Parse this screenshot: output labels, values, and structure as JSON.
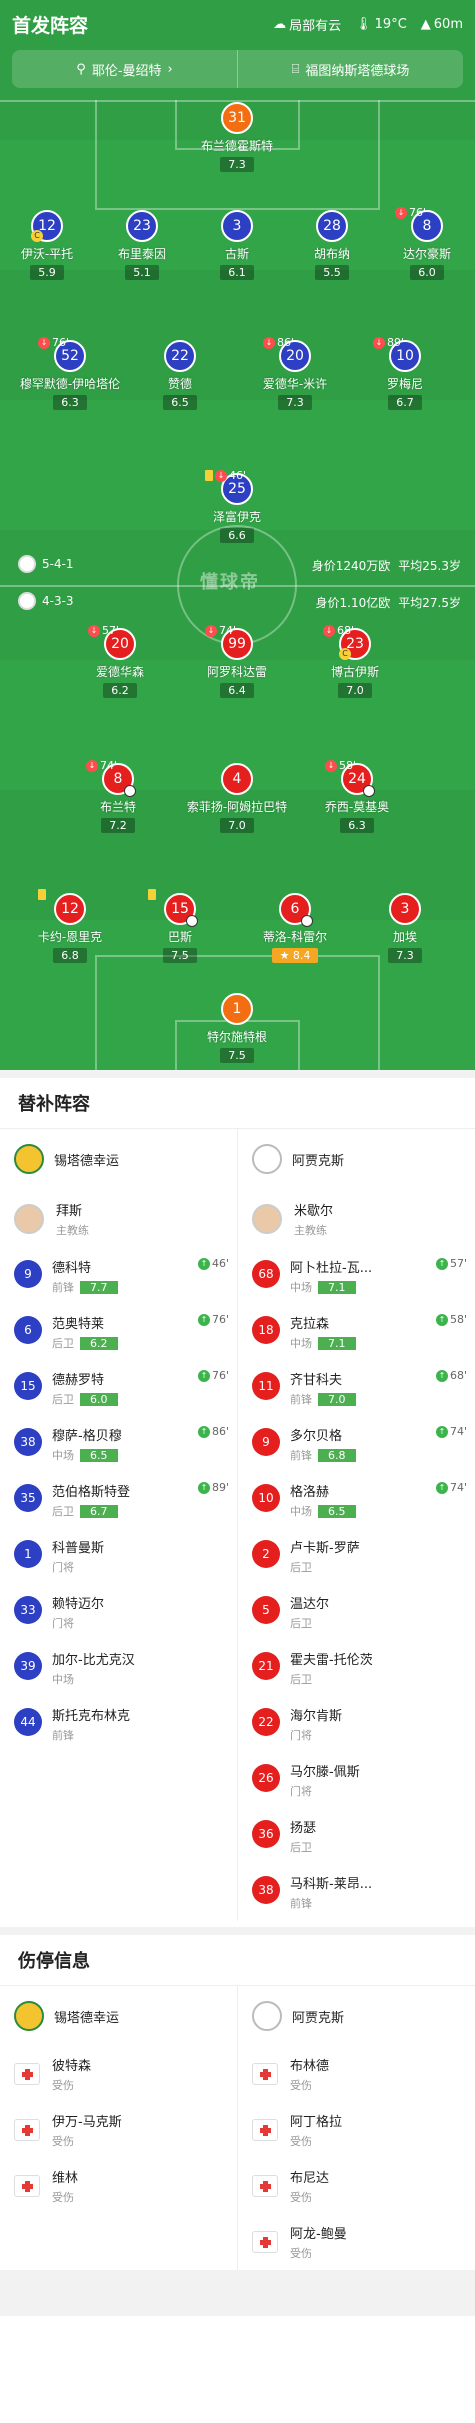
{
  "header": {
    "title": "首发阵容",
    "weather": "局部有云",
    "temp": "19°C",
    "altitude": "60m"
  },
  "match": {
    "referee": "耶伦-曼绍特",
    "venue": "福图纳斯塔德球场"
  },
  "home_info": {
    "formation": "5-4-1",
    "value": "身价1240万欧",
    "age": "平均25.3岁"
  },
  "away_info": {
    "formation": "4-3-3",
    "value": "身价1.10亿欧",
    "age": "平均27.5岁"
  },
  "watermark": "懂球帝",
  "pitch_players": [
    {
      "num": "31",
      "name": "布兰德霍斯特",
      "rating": "7.3"
    },
    {
      "num": "12",
      "name": "伊沃-平托",
      "rating": "5.9"
    },
    {
      "num": "23",
      "name": "布里泰因",
      "rating": "5.1"
    },
    {
      "num": "3",
      "name": "古斯",
      "rating": "6.1"
    },
    {
      "num": "28",
      "name": "胡布纳",
      "rating": "5.5"
    },
    {
      "num": "8",
      "name": "达尔豪斯",
      "rating": "6.0",
      "ev": "76'"
    },
    {
      "num": "52",
      "name": "穆罕默德-伊哈塔伦",
      "rating": "6.3",
      "ev": "76'"
    },
    {
      "num": "22",
      "name": "赞德",
      "rating": "6.5"
    },
    {
      "num": "20",
      "name": "爱德华-米许",
      "rating": "7.3",
      "ev": "86'"
    },
    {
      "num": "10",
      "name": "罗梅尼",
      "rating": "6.7",
      "ev": "89'"
    },
    {
      "num": "25",
      "name": "泽富伊克",
      "rating": "6.6",
      "ev": "46'"
    },
    {
      "num": "20",
      "name": "爱德华森",
      "rating": "6.2",
      "ev": "57'"
    },
    {
      "num": "99",
      "name": "阿罗科达雷",
      "rating": "6.4",
      "ev": "74'"
    },
    {
      "num": "23",
      "name": "博古伊斯",
      "rating": "7.0",
      "ev": "68'"
    },
    {
      "num": "8",
      "name": "布兰特",
      "rating": "7.2",
      "ev": "74'"
    },
    {
      "num": "4",
      "name": "索菲扬-阿姆拉巴特",
      "rating": "7.0"
    },
    {
      "num": "24",
      "name": "乔西-莫基奥",
      "rating": "6.3",
      "ev": "58'"
    },
    {
      "num": "12",
      "name": "卡约-恩里克",
      "rating": "6.8"
    },
    {
      "num": "15",
      "name": "巴斯",
      "rating": "7.5"
    },
    {
      "num": "6",
      "name": "蒂洛-科雷尔",
      "rating": "8.4"
    },
    {
      "num": "3",
      "name": "加埃",
      "rating": "7.3"
    },
    {
      "num": "1",
      "name": "特尔施特根",
      "rating": "7.5"
    }
  ],
  "subs": {
    "heading": "替补阵容",
    "home": {
      "team": "锡塔德幸运",
      "coach": "拜斯",
      "coach_role": "主教练",
      "players": [
        {
          "num": "9",
          "name": "德科特",
          "pos": "前锋",
          "rating": "7.7",
          "ev": "46'"
        },
        {
          "num": "6",
          "name": "范奥特莱",
          "pos": "后卫",
          "rating": "6.2",
          "ev": "76'"
        },
        {
          "num": "15",
          "name": "德赫罗特",
          "pos": "后卫",
          "rating": "6.0",
          "ev": "76'"
        },
        {
          "num": "38",
          "name": "穆萨-格贝穆",
          "pos": "中场",
          "rating": "6.5",
          "ev": "86'"
        },
        {
          "num": "35",
          "name": "范伯格斯特登",
          "pos": "后卫",
          "rating": "6.7",
          "ev": "89'"
        },
        {
          "num": "1",
          "name": "科普曼斯",
          "pos": "门将"
        },
        {
          "num": "33",
          "name": "赖特迈尔",
          "pos": "门将"
        },
        {
          "num": "39",
          "name": "加尔-比尤克汉",
          "pos": "中场"
        },
        {
          "num": "44",
          "name": "斯托克布林克",
          "pos": "前锋"
        }
      ]
    },
    "away": {
      "team": "阿贾克斯",
      "coach": "米歇尔",
      "coach_role": "主教练",
      "players": [
        {
          "num": "68",
          "name": "阿卜杜拉-瓦...",
          "pos": "中场",
          "rating": "7.1",
          "ev": "57'"
        },
        {
          "num": "18",
          "name": "克拉森",
          "pos": "中场",
          "rating": "7.1",
          "ev": "58'"
        },
        {
          "num": "11",
          "name": "齐甘科夫",
          "pos": "前锋",
          "rating": "7.0",
          "ev": "68'"
        },
        {
          "num": "9",
          "name": "多尔贝格",
          "pos": "前锋",
          "rating": "6.8",
          "ev": "74'"
        },
        {
          "num": "10",
          "name": "格洛赫",
          "pos": "中场",
          "rating": "6.5",
          "ev": "74'"
        },
        {
          "num": "2",
          "name": "卢卡斯-罗萨",
          "pos": "后卫"
        },
        {
          "num": "5",
          "name": "温达尔",
          "pos": "后卫"
        },
        {
          "num": "21",
          "name": "霍夫雷-托伦茨",
          "pos": "后卫"
        },
        {
          "num": "22",
          "name": "海尔肯斯",
          "pos": "门将"
        },
        {
          "num": "26",
          "name": "马尔滕-佩斯",
          "pos": "门将"
        },
        {
          "num": "36",
          "name": "扬瑟",
          "pos": "后卫"
        },
        {
          "num": "38",
          "name": "马科斯-莱昂...",
          "pos": "前锋"
        }
      ]
    }
  },
  "injuries": {
    "heading": "伤停信息",
    "home": {
      "team": "锡塔德幸运",
      "players": [
        {
          "name": "彼特森",
          "status": "受伤"
        },
        {
          "name": "伊万-马克斯",
          "status": "受伤"
        },
        {
          "name": "维林",
          "status": "受伤"
        }
      ]
    },
    "away": {
      "team": "阿贾克斯",
      "players": [
        {
          "name": "布林德",
          "status": "受伤"
        },
        {
          "name": "阿丁格拉",
          "status": "受伤"
        },
        {
          "name": "布尼达",
          "status": "受伤"
        },
        {
          "name": "阿龙-鲍曼",
          "status": "受伤"
        }
      ]
    }
  },
  "colors": {
    "pitch": "#2f9e44",
    "home": "#2d3fc2",
    "away": "#e51e1e",
    "gk": "#f36d12"
  }
}
